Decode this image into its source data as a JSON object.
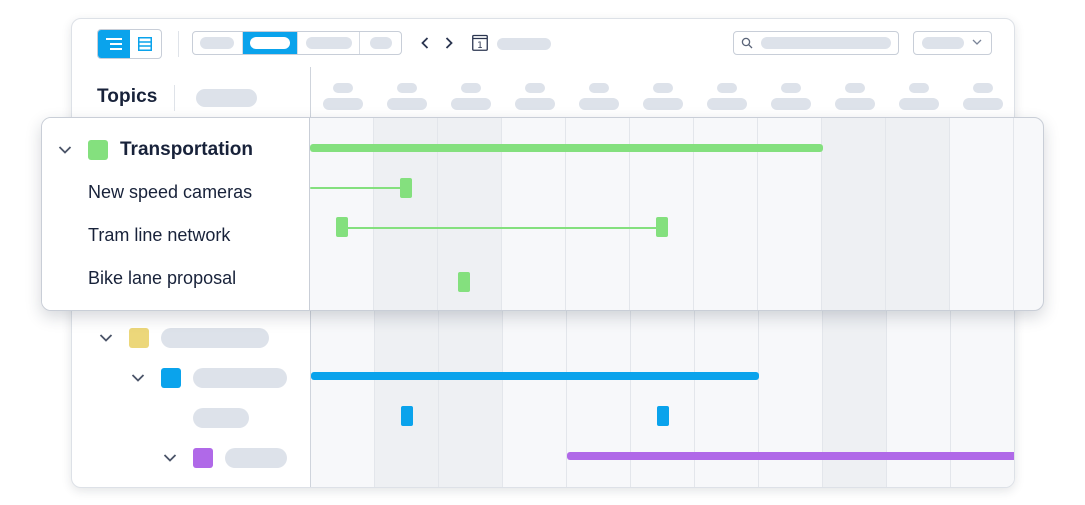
{
  "colors": {
    "accent": "#0aa3ec",
    "transportation": "#84e07e",
    "yellow_group": "#ecd77a",
    "blue_group": "#0aa3ec",
    "purple_group": "#b069e8",
    "placeholder": "#dde2ea",
    "text": "#18223a"
  },
  "toolbar": {
    "view_toggle_icons": [
      "list-indent-icon",
      "table-icon"
    ],
    "nav_prev_icon": "chevron-left-icon",
    "nav_next_icon": "chevron-right-icon",
    "calendar_icon_label": "1",
    "search_icon": "search-icon",
    "select_icon": "chevron-down-icon"
  },
  "sidebar": {
    "header_title": "Topics"
  },
  "focus_group": {
    "label": "Transportation",
    "items": [
      {
        "label": "New speed cameras"
      },
      {
        "label": "Tram line network"
      },
      {
        "label": "Bike lane proposal"
      }
    ]
  },
  "timeline": {
    "column_count": 11,
    "shaded_columns": [
      1,
      2,
      8
    ]
  }
}
